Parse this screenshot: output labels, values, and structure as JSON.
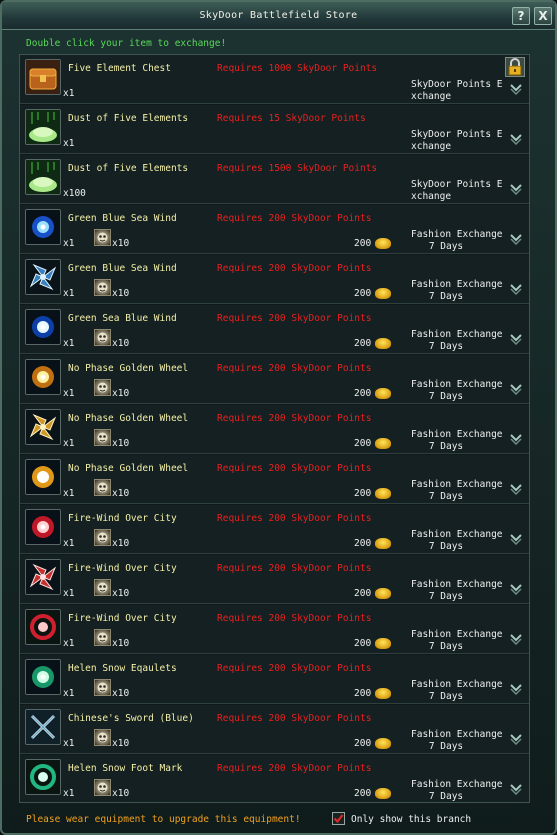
{
  "window": {
    "title": "SkyDoor Battlefield Store",
    "help_label": "?",
    "close_label": "X"
  },
  "hint": "Double click your item to exchange!",
  "items": [
    {
      "name": "Five Element Chest",
      "requirement": "Requires 1000 SkyDoor Points",
      "qty": "x1",
      "cost_qty": "",
      "price": "",
      "exchange_line1": "SkyDoor Points E",
      "exchange_line2": "xchange",
      "icon": "chest-icon",
      "kind": "points"
    },
    {
      "name": "Dust of Five Elements",
      "requirement": "Requires 15 SkyDoor Points",
      "qty": "x1",
      "cost_qty": "",
      "price": "",
      "exchange_line1": "SkyDoor Points E",
      "exchange_line2": "xchange",
      "icon": "dust-icon",
      "kind": "points"
    },
    {
      "name": "Dust of Five Elements",
      "requirement": "Requires 1500 SkyDoor Points",
      "qty": "x100",
      "cost_qty": "",
      "price": "",
      "exchange_line1": "SkyDoor Points E",
      "exchange_line2": "xchange",
      "icon": "dust-icon",
      "kind": "points"
    },
    {
      "name": "Green Blue Sea Wind",
      "requirement": "Requires 200 SkyDoor Points",
      "qty": "x1",
      "cost_qty": "x10",
      "price": "200",
      "exchange_line1": "Fashion Exchange",
      "exchange_line2": "7 Days",
      "icon": "blue-orb-icon",
      "kind": "fashion"
    },
    {
      "name": "Green Blue Sea Wind",
      "requirement": "Requires 200 SkyDoor Points",
      "qty": "x1",
      "cost_qty": "x10",
      "price": "200",
      "exchange_line1": "Fashion Exchange",
      "exchange_line2": "7 Days",
      "icon": "blue-pinwheel-icon",
      "kind": "fashion"
    },
    {
      "name": "Green Sea Blue Wind",
      "requirement": "Requires 200 SkyDoor Points",
      "qty": "x1",
      "cost_qty": "x10",
      "price": "200",
      "exchange_line1": "Fashion Exchange",
      "exchange_line2": "7 Days",
      "icon": "blue-swirl-icon",
      "kind": "fashion"
    },
    {
      "name": "No Phase Golden Wheel",
      "requirement": "Requires 200 SkyDoor Points",
      "qty": "x1",
      "cost_qty": "x10",
      "price": "200",
      "exchange_line1": "Fashion Exchange",
      "exchange_line2": "7 Days",
      "icon": "gold-orb-icon",
      "kind": "fashion"
    },
    {
      "name": "No Phase Golden Wheel",
      "requirement": "Requires 200 SkyDoor Points",
      "qty": "x1",
      "cost_qty": "x10",
      "price": "200",
      "exchange_line1": "Fashion Exchange",
      "exchange_line2": "7 Days",
      "icon": "gold-pinwheel-icon",
      "kind": "fashion"
    },
    {
      "name": "No Phase Golden Wheel",
      "requirement": "Requires 200 SkyDoor Points",
      "qty": "x1",
      "cost_qty": "x10",
      "price": "200",
      "exchange_line1": "Fashion Exchange",
      "exchange_line2": "7 Days",
      "icon": "gold-swirl-icon",
      "kind": "fashion"
    },
    {
      "name": "Fire-Wind Over City",
      "requirement": "Requires 200 SkyDoor Points",
      "qty": "x1",
      "cost_qty": "x10",
      "price": "200",
      "exchange_line1": "Fashion Exchange",
      "exchange_line2": "7 Days",
      "icon": "red-orb-icon",
      "kind": "fashion"
    },
    {
      "name": "Fire-Wind Over City",
      "requirement": "Requires 200 SkyDoor Points",
      "qty": "x1",
      "cost_qty": "x10",
      "price": "200",
      "exchange_line1": "Fashion Exchange",
      "exchange_line2": "7 Days",
      "icon": "red-pinwheel-icon",
      "kind": "fashion"
    },
    {
      "name": "Fire-Wind Over City",
      "requirement": "Requires 200 SkyDoor Points",
      "qty": "x1",
      "cost_qty": "x10",
      "price": "200",
      "exchange_line1": "Fashion Exchange",
      "exchange_line2": "7 Days",
      "icon": "red-ring-icon",
      "kind": "fashion"
    },
    {
      "name": "Helen Snow Eqaulets",
      "requirement": "Requires 200 SkyDoor Points",
      "qty": "x1",
      "cost_qty": "x10",
      "price": "200",
      "exchange_line1": "Fashion Exchange",
      "exchange_line2": "7 Days",
      "icon": "green-orb-icon",
      "kind": "fashion"
    },
    {
      "name": "Chinese's Sword (Blue)",
      "requirement": "Requires 200 SkyDoor Points",
      "qty": "x1",
      "cost_qty": "x10",
      "price": "200",
      "exchange_line1": "Fashion Exchange",
      "exchange_line2": "7 Days",
      "icon": "crossed-swords-icon",
      "kind": "fashion"
    },
    {
      "name": "Helen Snow Foot Mark",
      "requirement": "Requires 200 SkyDoor Points",
      "qty": "x1",
      "cost_qty": "x10",
      "price": "200",
      "exchange_line1": "Fashion Exchange",
      "exchange_line2": "7 Days",
      "icon": "green-ring-icon",
      "kind": "fashion"
    }
  ],
  "footer": {
    "message": "Please wear equipment to upgrade this equipment!",
    "checkbox_label": "Only show this branch",
    "checkbox_checked": true
  },
  "colors": {
    "item_name": "#f5f0a8",
    "requirement": "#e82020",
    "hint": "#58d858",
    "footer_message": "#f0a020"
  }
}
